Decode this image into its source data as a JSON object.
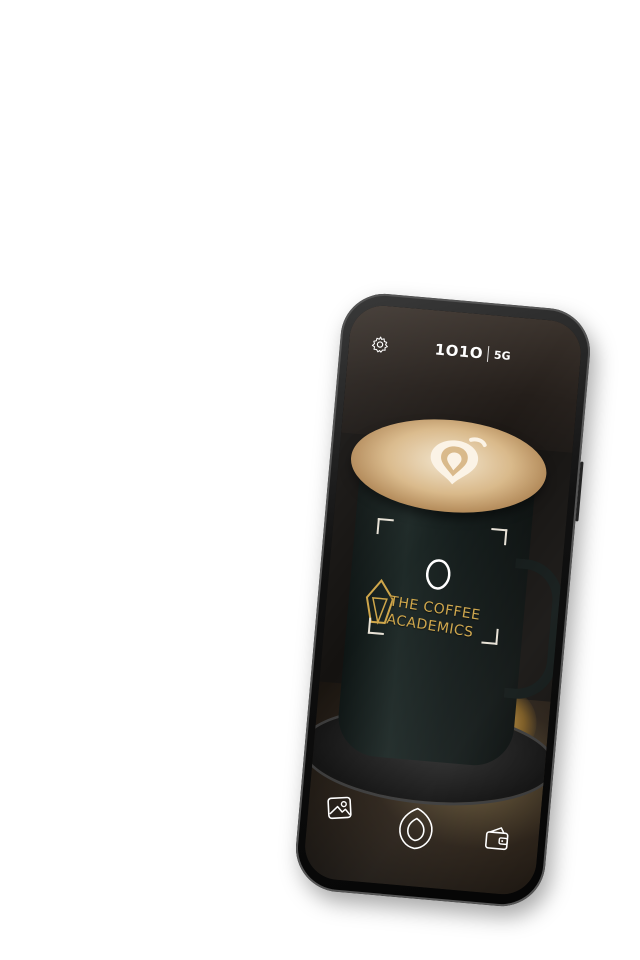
{
  "app": {
    "brand_name": "1O1O",
    "brand_suffix": "5G"
  },
  "camera_view": {
    "subject_text": {
      "line1": "THE COFFEE",
      "line2": "ACADEMICS"
    }
  },
  "toolbar": {
    "icons": [
      "gallery-icon",
      "shutter-icon",
      "wallet-icon"
    ]
  },
  "header": {
    "icons": [
      "gear-icon"
    ]
  },
  "colors": {
    "brand_gold": "#cfa64a",
    "ui_white": "#ffffff",
    "frame_white": "#e8e2d6"
  }
}
